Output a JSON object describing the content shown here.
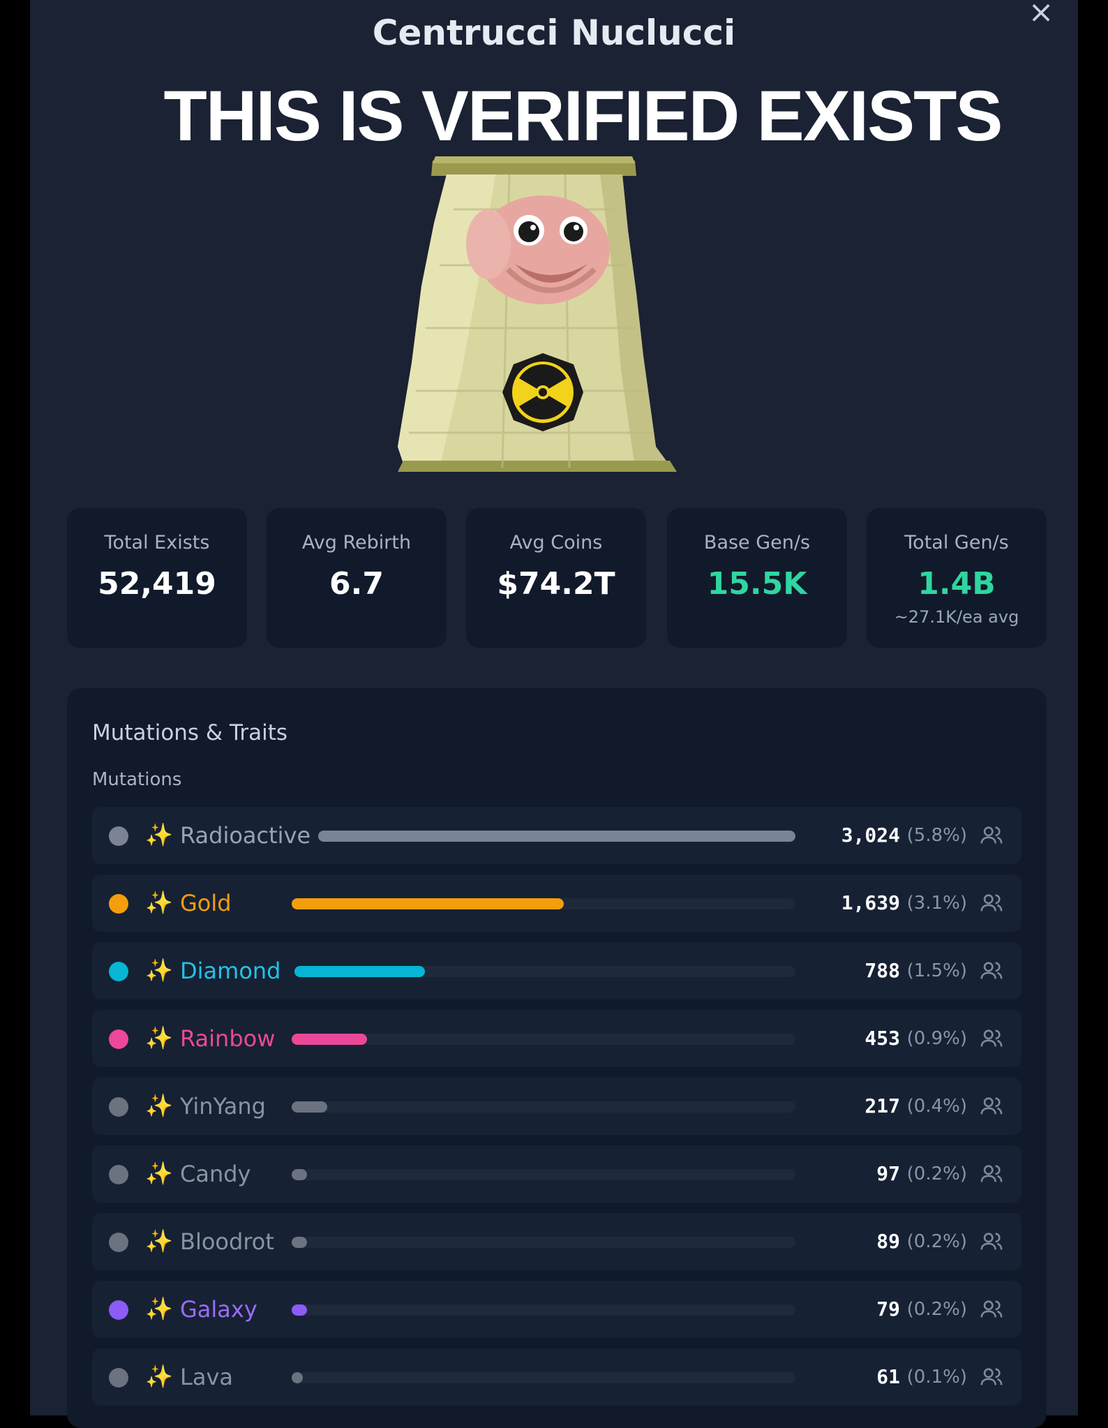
{
  "header": {
    "title": "Centrucci Nuclucci",
    "close_label": "×",
    "caption": "THIS IS VERIFIED EXISTS"
  },
  "character": {
    "name": "nuclear-reactor-character",
    "emblem": "radiation-symbol"
  },
  "stats": [
    {
      "label": "Total Exists",
      "value": "52,419",
      "sub": ""
    },
    {
      "label": "Avg Rebirth",
      "value": "6.7",
      "sub": ""
    },
    {
      "label": "Avg Coins",
      "value": "$74.2T",
      "sub": ""
    },
    {
      "label": "Base Gen/s",
      "value": "15.5K",
      "sub": "",
      "accent": "#2fd6a0"
    },
    {
      "label": "Total Gen/s",
      "value": "1.4B",
      "sub": "~27.1K/ea avg",
      "accent": "#2fd6a0"
    }
  ],
  "traits": {
    "title": "Mutations & Traits",
    "subtitle": "Mutations",
    "icon": "sparkle-icon",
    "mutations": [
      {
        "name": "Radioactive",
        "count": "3,024",
        "percent": "(5.8%)",
        "fill": 1.0,
        "color": "#7b8494",
        "text_color": "#9aa3b2"
      },
      {
        "name": "Gold",
        "count": "1,639",
        "percent": "(3.1%)",
        "fill": 0.54,
        "color": "#f59e0b",
        "text_color": "#f59e0b"
      },
      {
        "name": "Diamond",
        "count": "788",
        "percent": "(1.5%)",
        "fill": 0.26,
        "color": "#06b6d4",
        "text_color": "#22c3e6"
      },
      {
        "name": "Rainbow",
        "count": "453",
        "percent": "(0.9%)",
        "fill": 0.15,
        "color": "#ec4899",
        "text_color": "#ec4899"
      },
      {
        "name": "YinYang",
        "count": "217",
        "percent": "(0.4%)",
        "fill": 0.07,
        "color": "#6b7280",
        "text_color": "#8b93a1"
      },
      {
        "name": "Candy",
        "count": "97",
        "percent": "(0.2%)",
        "fill": 0.03,
        "color": "#6b7280",
        "text_color": "#8b93a1"
      },
      {
        "name": "Bloodrot",
        "count": "89",
        "percent": "(0.2%)",
        "fill": 0.03,
        "color": "#6b7280",
        "text_color": "#8b93a1"
      },
      {
        "name": "Galaxy",
        "count": "79",
        "percent": "(0.2%)",
        "fill": 0.03,
        "color": "#8b5cf6",
        "text_color": "#9b6cf7"
      },
      {
        "name": "Lava",
        "count": "61",
        "percent": "(0.1%)",
        "fill": 0.02,
        "color": "#6b7280",
        "text_color": "#8b93a1"
      }
    ]
  }
}
